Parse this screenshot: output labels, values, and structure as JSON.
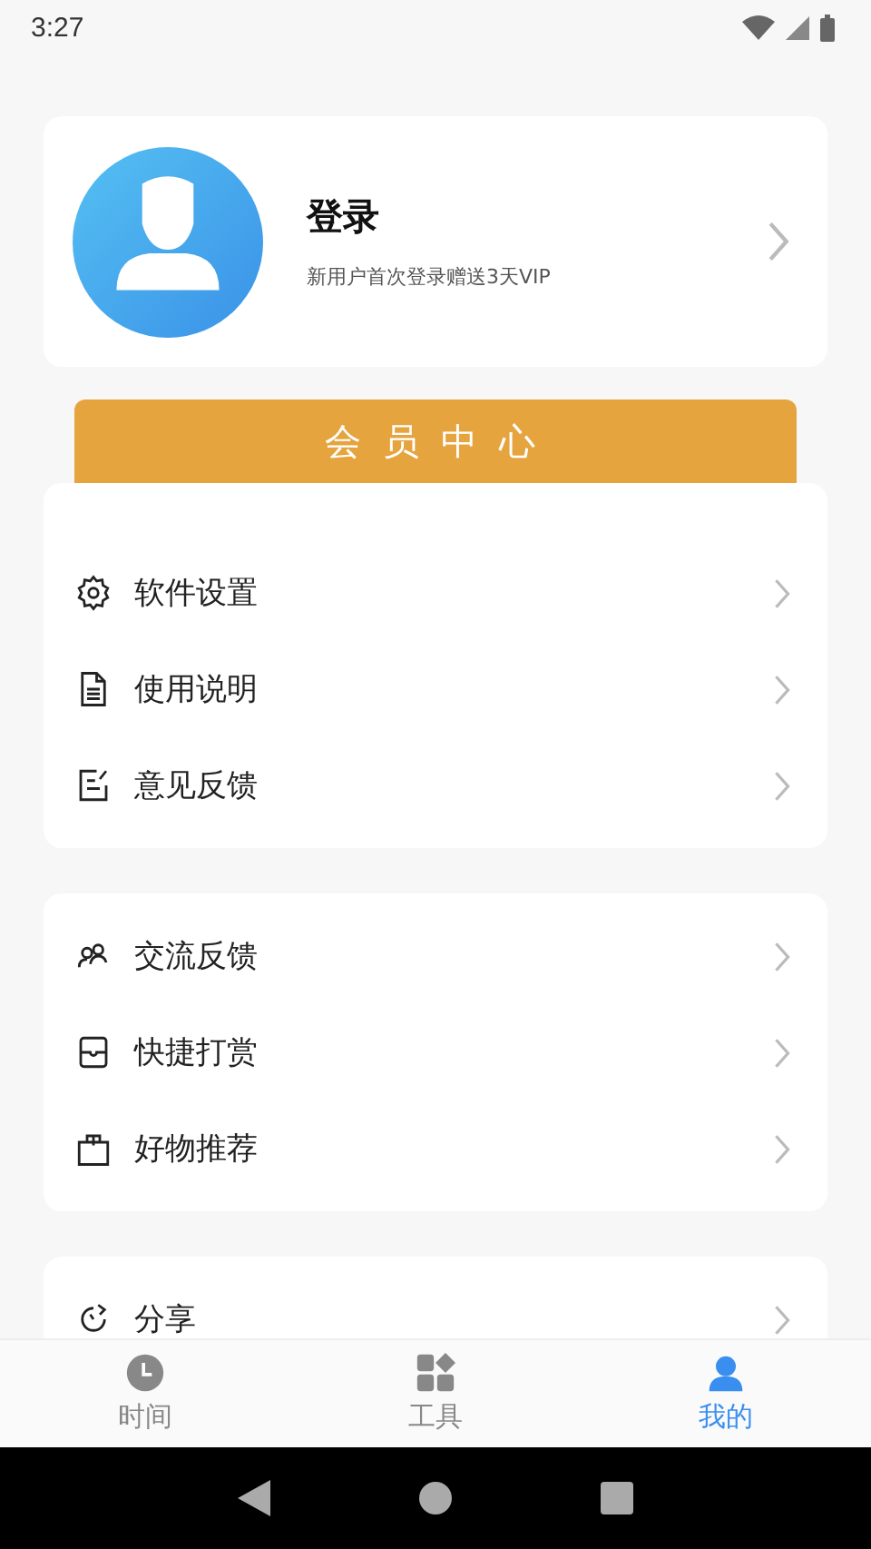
{
  "status_bar": {
    "time": "3:27"
  },
  "profile": {
    "title": "登录",
    "subtitle": "新用户首次登录赠送3天VIP"
  },
  "vip_button": {
    "label": "会员中心"
  },
  "menu_groups": [
    {
      "items": [
        {
          "label": "软件设置",
          "kind": "gear"
        },
        {
          "label": "使用说明",
          "kind": "document"
        },
        {
          "label": "意见反馈",
          "kind": "edit"
        }
      ]
    },
    {
      "items": [
        {
          "label": "交流反馈",
          "kind": "people"
        },
        {
          "label": "快捷打赏",
          "kind": "wallet"
        },
        {
          "label": "好物推荐",
          "kind": "bag"
        }
      ]
    },
    {
      "items": [
        {
          "label": "分享",
          "kind": "share"
        }
      ]
    }
  ],
  "tabs": [
    {
      "label": "时间",
      "kind": "clock",
      "selected": false
    },
    {
      "label": "工具",
      "kind": "grid",
      "selected": false
    },
    {
      "label": "我的",
      "kind": "person",
      "selected": true
    }
  ]
}
